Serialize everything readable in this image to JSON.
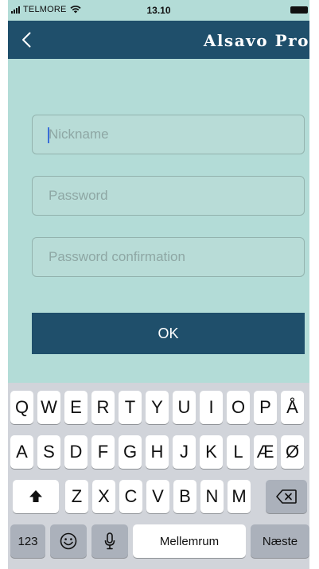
{
  "status_bar": {
    "carrier": "TELMORE",
    "time": "13.10"
  },
  "nav": {
    "title": "Alsavo Pro"
  },
  "form": {
    "nickname_placeholder": "Nickname",
    "password_placeholder": "Password",
    "confirm_placeholder": "Password confirmation",
    "ok_label": "OK"
  },
  "keyboard": {
    "row1": [
      "Q",
      "W",
      "E",
      "R",
      "T",
      "Y",
      "U",
      "I",
      "O",
      "P",
      "Å"
    ],
    "row2": [
      "A",
      "S",
      "D",
      "F",
      "G",
      "H",
      "J",
      "K",
      "L",
      "Æ",
      "Ø"
    ],
    "row3": [
      "Z",
      "X",
      "C",
      "V",
      "B",
      "N",
      "M"
    ],
    "numbers_label": "123",
    "space_label": "Mellemrum",
    "next_label": "Næste"
  },
  "colors": {
    "accent": "#1f4f6b",
    "background": "#b3dcd7",
    "keyboard_bg": "#d1d4da"
  }
}
